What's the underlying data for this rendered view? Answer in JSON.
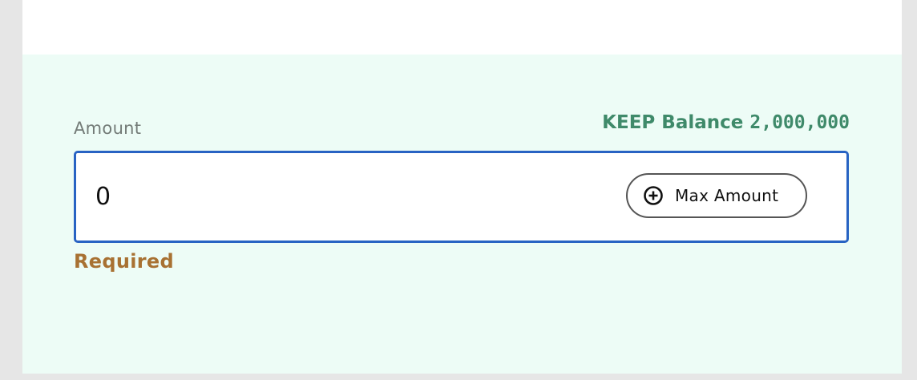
{
  "form": {
    "amount_label": "Amount",
    "balance": {
      "label": "KEEP Balance",
      "value": "2,000,000"
    },
    "amount_input": {
      "value": "0",
      "placeholder": ""
    },
    "max_button": {
      "label": "Max Amount",
      "icon": "plus-circle-icon"
    },
    "error": "Required"
  },
  "colors": {
    "panel_background": "#edfcf6",
    "input_border_focus": "#2863c3",
    "balance_text": "#3f8a6a",
    "error_text": "#a87132"
  }
}
